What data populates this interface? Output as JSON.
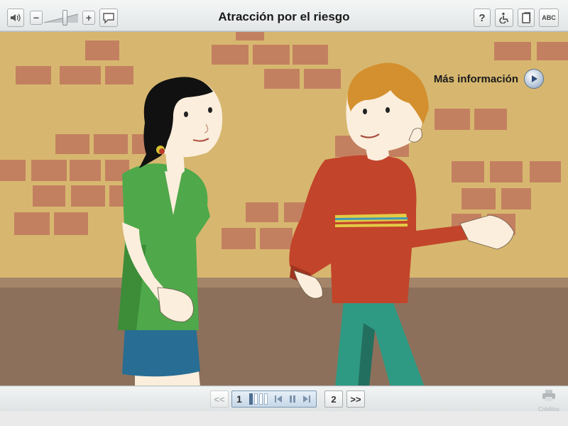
{
  "title": "Atracción por el riesgo",
  "toolbar": {
    "left_icons": [
      "speaker-icon",
      "volume-down-icon",
      "volume-slider",
      "volume-up-icon",
      "speech-bubble-icon"
    ],
    "volume_minus": "−",
    "volume_plus": "+",
    "volume_level": 0.55,
    "right_icons": [
      "help-icon",
      "accessibility-icon",
      "glossary-icon",
      "spelling-icon"
    ],
    "help_label": "?",
    "abc_label": "ABC"
  },
  "scene": {
    "more_info_label": "Más información",
    "colors": {
      "wall": "#d7b76f",
      "brick": "#c38060",
      "floor": "#8d705b",
      "girl_shirt": "#4fa84a",
      "girl_skirt": "#286d94",
      "boy_sweater": "#c2442a",
      "boy_pants": "#2f9a83",
      "boy_hair": "#d4902e",
      "skin": "#fbeedd"
    }
  },
  "navigation": {
    "prev_label": "<<",
    "current_page": "1",
    "page_two_label": "2",
    "next_label": ">>",
    "progress_segments": 4,
    "progress_filled": 1,
    "credits_label": "Créditos"
  }
}
